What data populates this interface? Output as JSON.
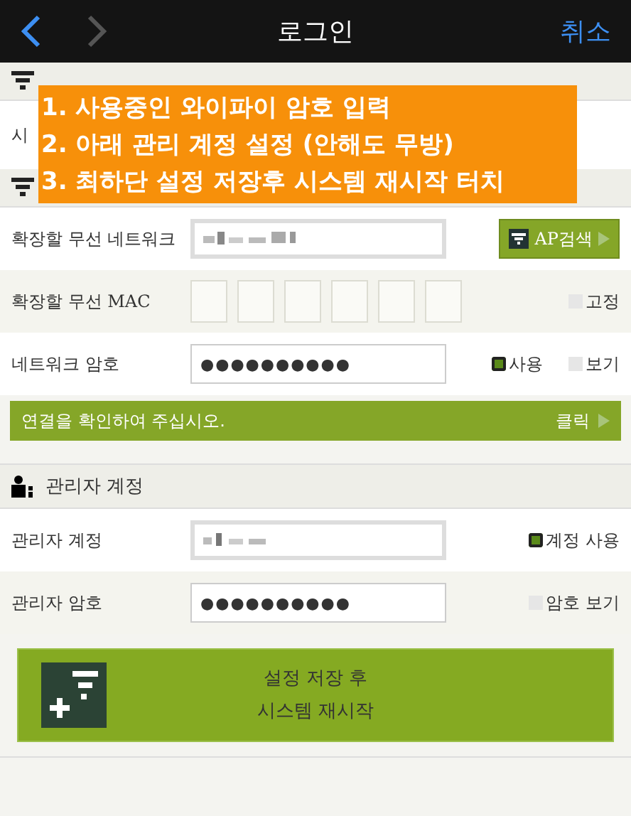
{
  "header": {
    "title": "로그인",
    "cancel": "취소",
    "back_enabled": true,
    "forward_enabled": false
  },
  "notice": {
    "lines": [
      "1. 사용중인 와이파이 암호 입력",
      "2. 아래 관리 계정 설정 (안해도 무방)",
      "3. 최하단 설정 저장후 시스템 재시작 터치"
    ]
  },
  "network_section": {
    "row_label": "시"
  },
  "wireless": {
    "network_label": "확장할 무선 네트워크",
    "scan_button": "AP검색",
    "mac_label": "확장할 무선 MAC",
    "mac_fixed": {
      "label": "고정",
      "checked": false
    },
    "password_label": "네트워크 암호",
    "password": "●●●●●●●●●●",
    "use": {
      "label": "사용",
      "checked": true
    },
    "show": {
      "label": "보기",
      "checked": false
    },
    "check_bar": {
      "text": "연결을 확인하여 주십시오.",
      "action": "클릭"
    }
  },
  "admin": {
    "title": "관리자 계정",
    "account_label": "관리자 계정",
    "account_use": {
      "label": "계정 사용",
      "checked": true
    },
    "password_label": "관리자 암호",
    "password": "●●●●●●●●●●",
    "show": {
      "label": "암호 보기",
      "checked": false
    }
  },
  "save_button": {
    "line1": "설정 저장 후",
    "line2": "시스템 재시작"
  }
}
